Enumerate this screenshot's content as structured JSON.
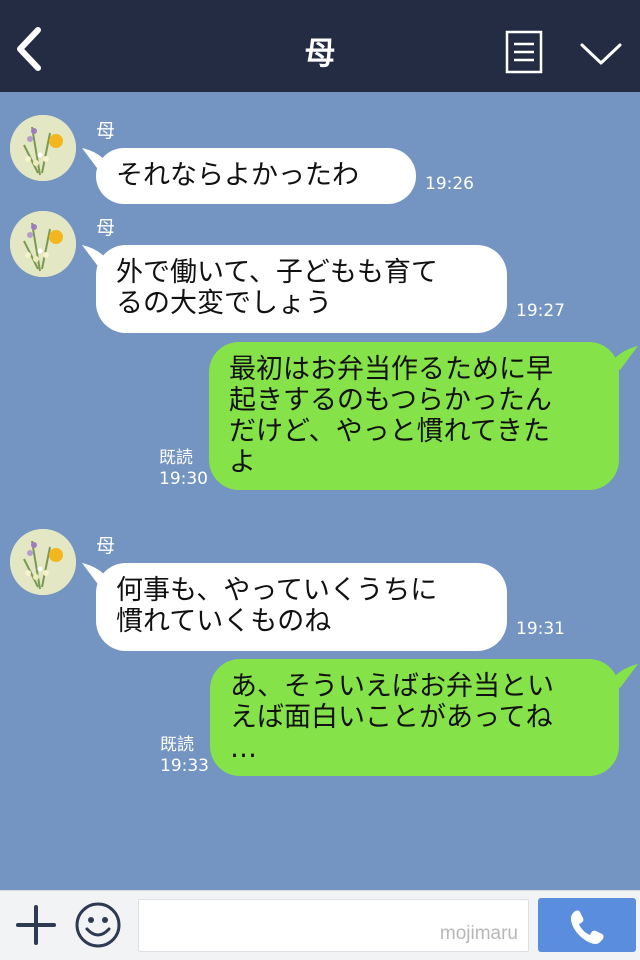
{
  "header": {
    "title": "母",
    "back_icon": "chevron-left-icon",
    "notes_icon": "notes-icon",
    "collapse_icon": "chevron-down-icon"
  },
  "messages": [
    {
      "sender": "母",
      "lines": [
        "それならよかったわ"
      ],
      "time": "19:26"
    },
    {
      "sender": "母",
      "lines": [
        "外で働いて、子どもも育て",
        "るの大変でしょう"
      ],
      "time": "19:27"
    },
    {
      "read": "既読",
      "lines": [
        "最初はお弁当作るために早",
        "起きするのもつらかったん",
        "だけど、やっと慣れてきた",
        "よ"
      ],
      "time": "19:30"
    },
    {
      "sender": "母",
      "lines": [
        "何事も、やっていくうちに",
        "慣れていくものね"
      ],
      "time": "19:31"
    },
    {
      "read": "既読",
      "lines": [
        "あ、そういえばお弁当とい",
        "えば面白いことがあってね",
        "…"
      ],
      "time": "19:33"
    }
  ],
  "input": {
    "placeholder": "",
    "watermark": "mojimaru"
  },
  "icons": {
    "add": "plus-icon",
    "emoji": "smiley-icon",
    "call": "phone-icon"
  },
  "colors": {
    "header_bg": "#232c42",
    "chat_bg": "#7494c1",
    "incoming_bubble": "#ffffff",
    "outgoing_bubble": "#85e249",
    "call_button": "#5b8ddf"
  }
}
